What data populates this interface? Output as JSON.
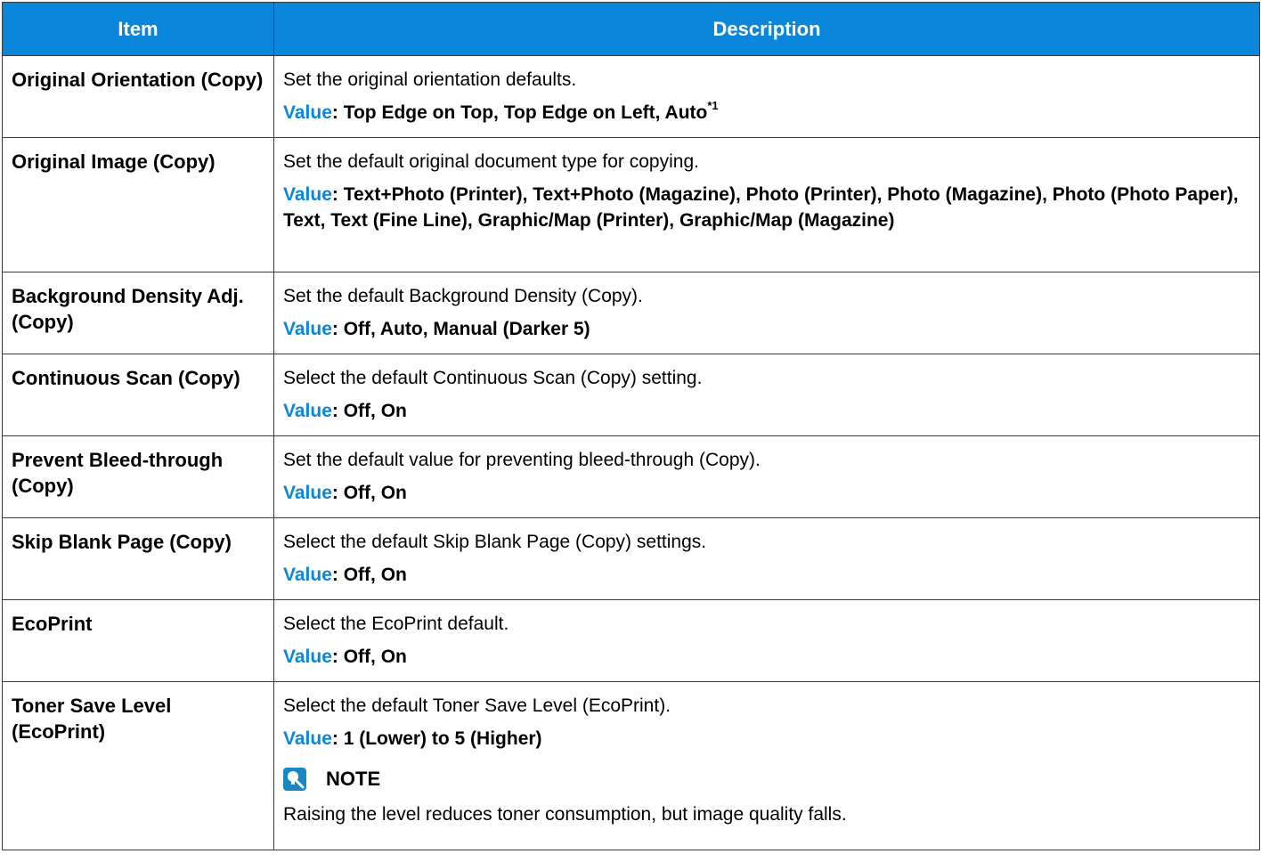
{
  "header": {
    "item": "Item",
    "description": "Description"
  },
  "value_label": "Value",
  "rows": [
    {
      "item": "Original Orientation (Copy)",
      "text": "Set the original orientation defaults.",
      "value": ": Top Edge on Top, Top Edge on Left, Auto",
      "footnote": "*1"
    },
    {
      "item": "Original Image (Copy)",
      "text": "Set the default original document type for copying.",
      "value": ": Text+Photo (Printer), Text+Photo (Magazine), Photo (Printer), Photo (Magazine), Photo (Photo Paper), Text, Text (Fine Line), Graphic/Map (Printer), Graphic/Map (Magazine)"
    },
    {
      "item": "Background Density Adj. (Copy)",
      "text": "Set the default Background Density (Copy).",
      "value": ": Off, Auto, Manual (Darker 5)"
    },
    {
      "item": "Continuous Scan (Copy)",
      "text": "Select the default Continuous Scan (Copy) setting.",
      "value": ": Off, On"
    },
    {
      "item": "Prevent Bleed-through (Copy)",
      "text": "Set the default value for preventing bleed-through (Copy).",
      "value": ": Off, On"
    },
    {
      "item": "Skip Blank Page (Copy)",
      "text": "Select the default Skip Blank Page (Copy) settings.",
      "value": ": Off, On"
    },
    {
      "item": "EcoPrint",
      "text": "Select the EcoPrint default.",
      "value": ": Off, On"
    },
    {
      "item": "Toner Save Level (EcoPrint)",
      "text": "Select the default Toner Save Level (EcoPrint).",
      "value": ": 1 (Lower) to 5 (Higher)",
      "note_title": "NOTE",
      "note_text": "Raising the level reduces toner consumption, but image quality falls.",
      "note_icon": "note-icon"
    }
  ],
  "colors": {
    "header_bg": "#0a87db",
    "value_label": "#0a87db"
  }
}
